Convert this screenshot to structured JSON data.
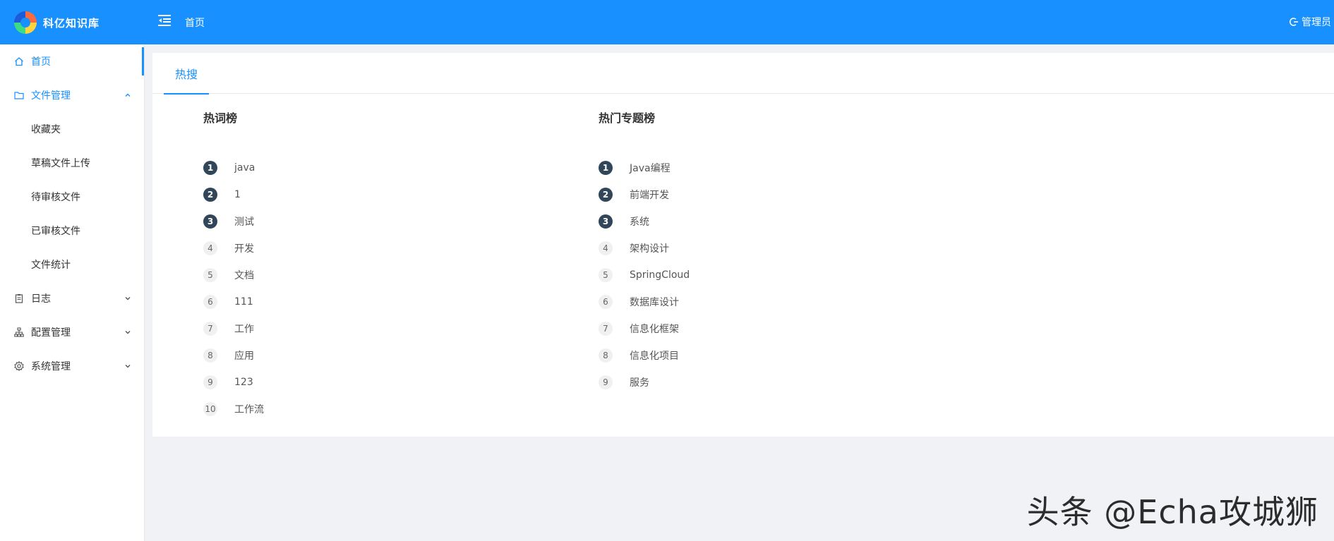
{
  "app": {
    "title": "科亿知识库",
    "breadcrumb": "首页",
    "user_label": "管理员"
  },
  "sidebar": {
    "items": [
      {
        "label": "首页",
        "icon": "home-icon",
        "state": "active"
      },
      {
        "label": "文件管理",
        "icon": "folder-icon",
        "state": "open"
      },
      {
        "label": "日志",
        "icon": "clipboard-icon",
        "state": "collapsed"
      },
      {
        "label": "配置管理",
        "icon": "sitemap-icon",
        "state": "collapsed"
      },
      {
        "label": "系统管理",
        "icon": "gear-icon",
        "state": "collapsed"
      }
    ],
    "file_submenu": [
      "收藏夹",
      "草稿文件上传",
      "待审核文件",
      "已审核文件",
      "文件统计"
    ]
  },
  "tabs": [
    "热搜"
  ],
  "hot_words": {
    "title": "热词榜",
    "items": [
      {
        "rank": "1",
        "label": "java"
      },
      {
        "rank": "2",
        "label": "1"
      },
      {
        "rank": "3",
        "label": "测试"
      },
      {
        "rank": "4",
        "label": "开发"
      },
      {
        "rank": "5",
        "label": "文档"
      },
      {
        "rank": "6",
        "label": "111"
      },
      {
        "rank": "7",
        "label": "工作"
      },
      {
        "rank": "8",
        "label": "应用"
      },
      {
        "rank": "9",
        "label": "123"
      },
      {
        "rank": "10",
        "label": "工作流"
      }
    ]
  },
  "hot_topics": {
    "title": "热门专题榜",
    "items": [
      {
        "rank": "1",
        "label": "Java编程"
      },
      {
        "rank": "2",
        "label": "前端开发"
      },
      {
        "rank": "3",
        "label": "系统"
      },
      {
        "rank": "4",
        "label": "架构设计"
      },
      {
        "rank": "5",
        "label": "SpringCloud"
      },
      {
        "rank": "6",
        "label": "数据库设计"
      },
      {
        "rank": "7",
        "label": "信息化框架"
      },
      {
        "rank": "8",
        "label": "信息化项目"
      },
      {
        "rank": "9",
        "label": "服务"
      }
    ]
  },
  "watermark": "头条 @Echa攻城狮",
  "colors": {
    "primary": "#1890ff",
    "top_rank_badge": "#314659",
    "background": "#f0f2f5"
  }
}
